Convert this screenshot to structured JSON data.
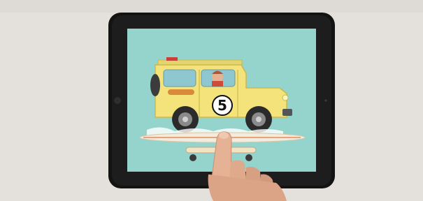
{
  "scene": {
    "background_color": "#e4e1dc",
    "tablet_color": "#131313",
    "screen_color": "#95d4cc",
    "vehicle": {
      "body_color": "#f3e37a",
      "roof_rack_color": "#e5d46d",
      "number_badge": "5",
      "number_badge_bg": "#ffffff",
      "number_badge_text_color": "#111111"
    },
    "icons": [
      "tablet-icon",
      "jeep-illustration",
      "driver-icon",
      "surfboard-icon",
      "skateboard-icon",
      "hand-icon"
    ]
  }
}
